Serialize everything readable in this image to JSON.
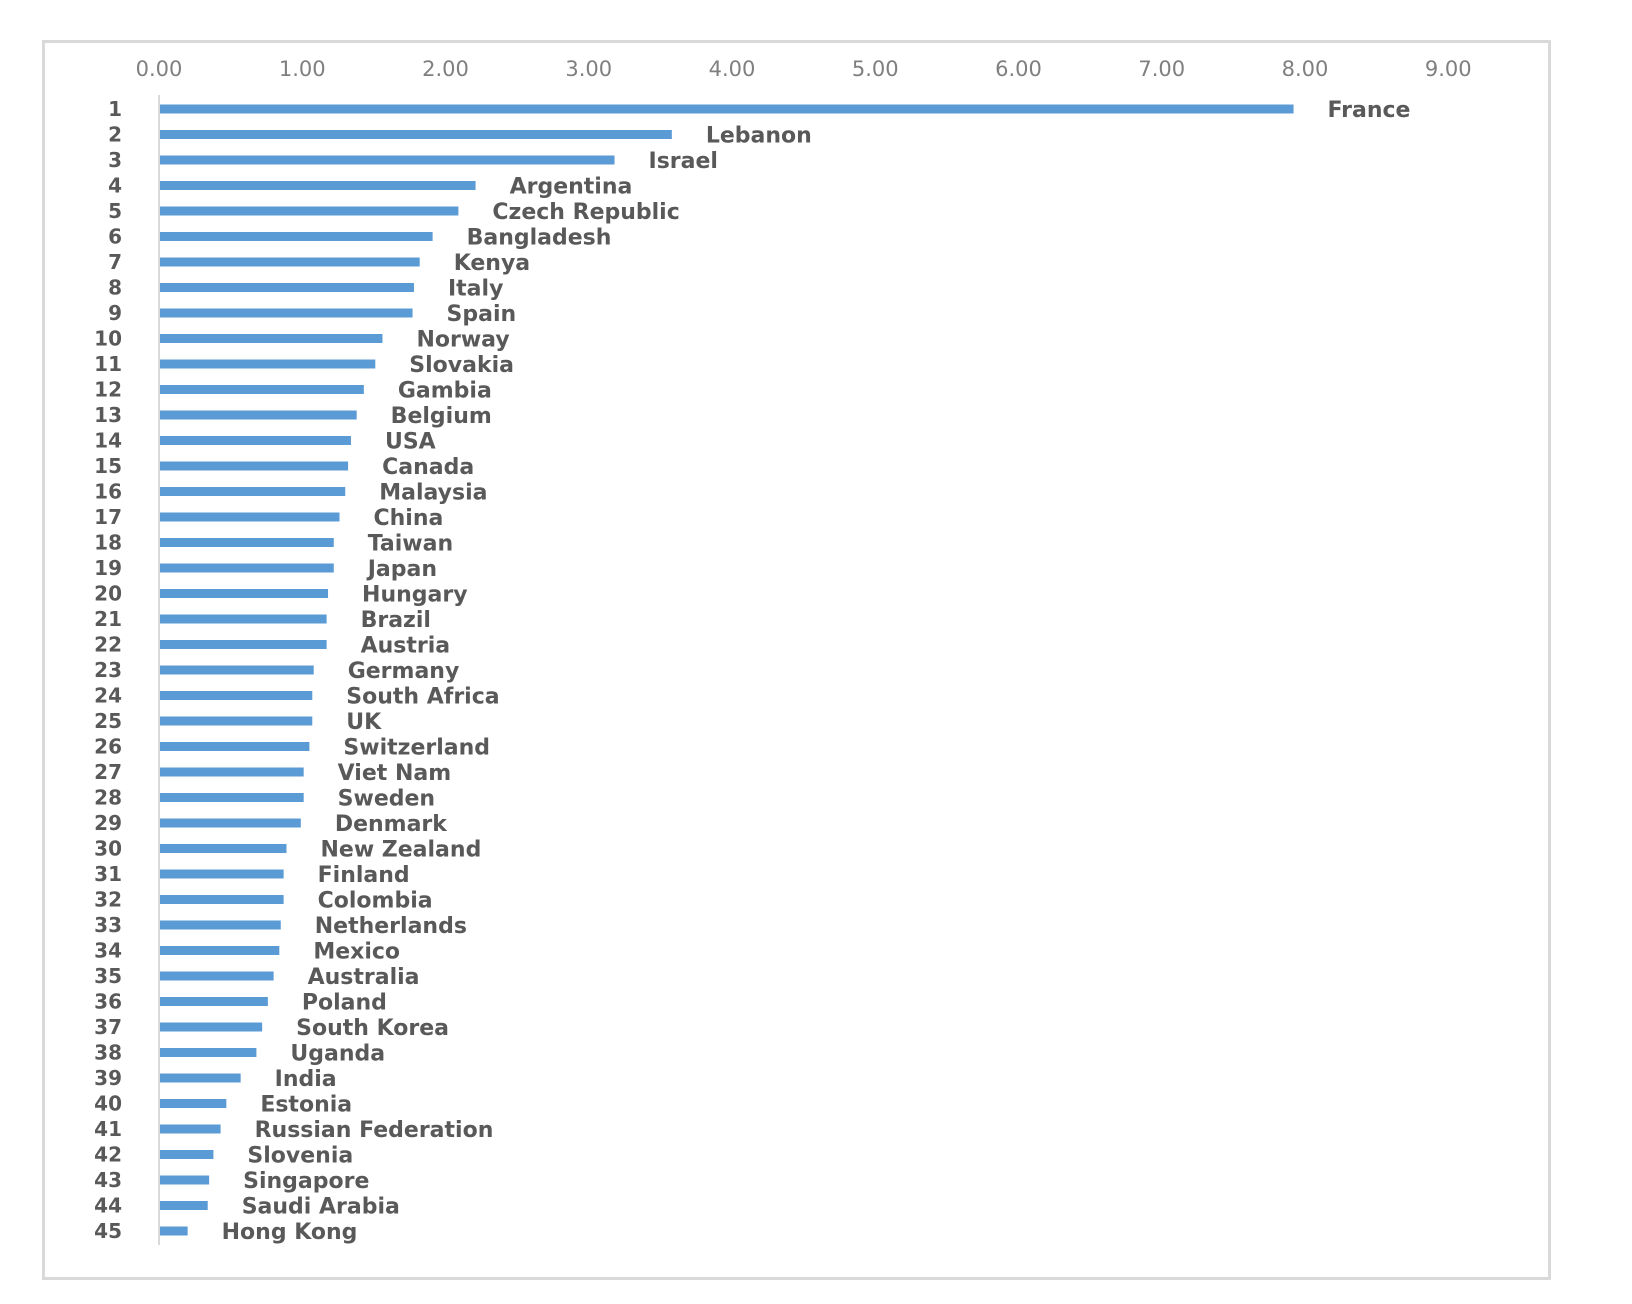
{
  "chart_data": {
    "type": "bar",
    "orientation": "horizontal",
    "title": "",
    "xlabel": "",
    "ylabel": "",
    "xlim": [
      0,
      9
    ],
    "x_ticks": [
      "0.00",
      "1.00",
      "2.00",
      "3.00",
      "4.00",
      "5.00",
      "6.00",
      "7.00",
      "8.00",
      "9.00"
    ],
    "x_axis_position": "top",
    "grid": false,
    "legend": "none",
    "bar_color": "#5b9bd5",
    "data_labels": "category name at bar end",
    "categories": [
      "1",
      "2",
      "3",
      "4",
      "5",
      "6",
      "7",
      "8",
      "9",
      "10",
      "11",
      "12",
      "13",
      "14",
      "15",
      "16",
      "17",
      "18",
      "19",
      "20",
      "21",
      "22",
      "23",
      "24",
      "25",
      "26",
      "27",
      "28",
      "29",
      "30",
      "31",
      "32",
      "33",
      "34",
      "35",
      "36",
      "37",
      "38",
      "39",
      "40",
      "41",
      "42",
      "43",
      "44",
      "45"
    ],
    "labels": [
      "France",
      "Lebanon",
      "Israel",
      "Argentina",
      "Czech Republic",
      "Bangladesh",
      "Kenya",
      "Italy",
      "Spain",
      "Norway",
      "Slovakia",
      "Gambia",
      "Belgium",
      "USA",
      "Canada",
      "Malaysia",
      "China",
      "Taiwan",
      "Japan",
      "Hungary",
      "Brazil",
      "Austria",
      "Germany",
      "South Africa",
      "UK",
      "Switzerland",
      "Viet Nam",
      "Sweden",
      "Denmark",
      "New Zealand",
      "Finland",
      "Colombia",
      "Netherlands",
      "Mexico",
      "Australia",
      "Poland",
      "South Korea",
      "Uganda",
      "India",
      "Estonia",
      "Russian Federation",
      "Slovenia",
      "Singapore",
      "Saudi Arabia",
      "Hong Kong"
    ],
    "values": [
      7.92,
      3.58,
      3.18,
      2.21,
      2.09,
      1.91,
      1.82,
      1.78,
      1.77,
      1.56,
      1.51,
      1.43,
      1.38,
      1.34,
      1.32,
      1.3,
      1.26,
      1.22,
      1.22,
      1.18,
      1.17,
      1.17,
      1.08,
      1.07,
      1.07,
      1.05,
      1.01,
      1.01,
      0.99,
      0.89,
      0.87,
      0.87,
      0.85,
      0.84,
      0.8,
      0.76,
      0.72,
      0.68,
      0.57,
      0.47,
      0.43,
      0.38,
      0.35,
      0.34,
      0.2
    ]
  }
}
